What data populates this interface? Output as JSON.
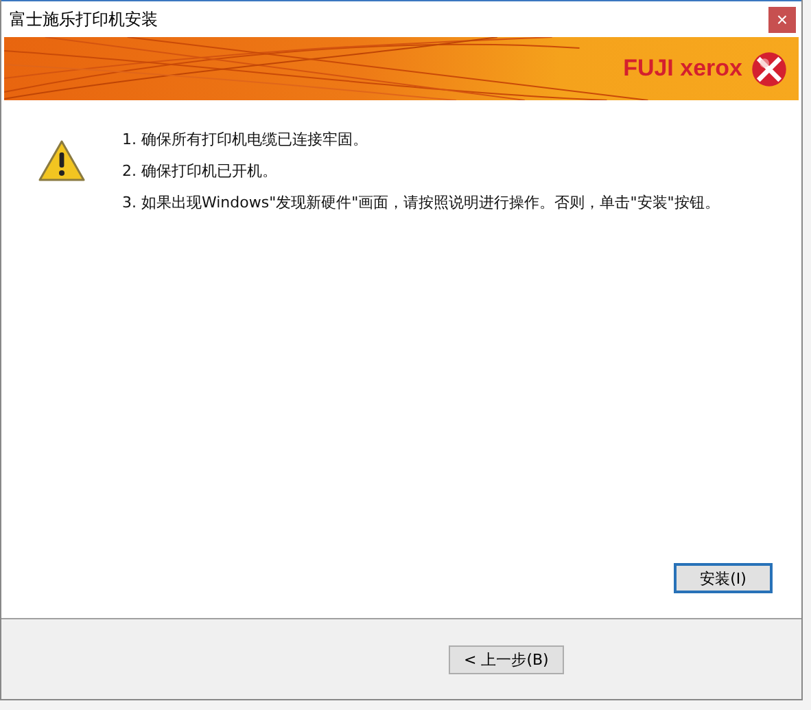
{
  "window": {
    "title": "富士施乐打印机安装",
    "close": "×"
  },
  "banner": {
    "logo": "FUJI xerox"
  },
  "instructions": [
    {
      "text": "1. 确保所有打印机电缆已连接牢固。"
    },
    {
      "text": "2. 确保打印机已开机。"
    },
    {
      "text": "3. 如果出现Windows\"发现新硬件\"画面，请按照说明进行操作。否则，单击\"安装\"按钮。"
    }
  ],
  "install_button": {
    "label": "安装(I)",
    "focused": true
  },
  "footer_buttons": [
    {
      "label": "< 上一步(B)"
    }
  ]
}
